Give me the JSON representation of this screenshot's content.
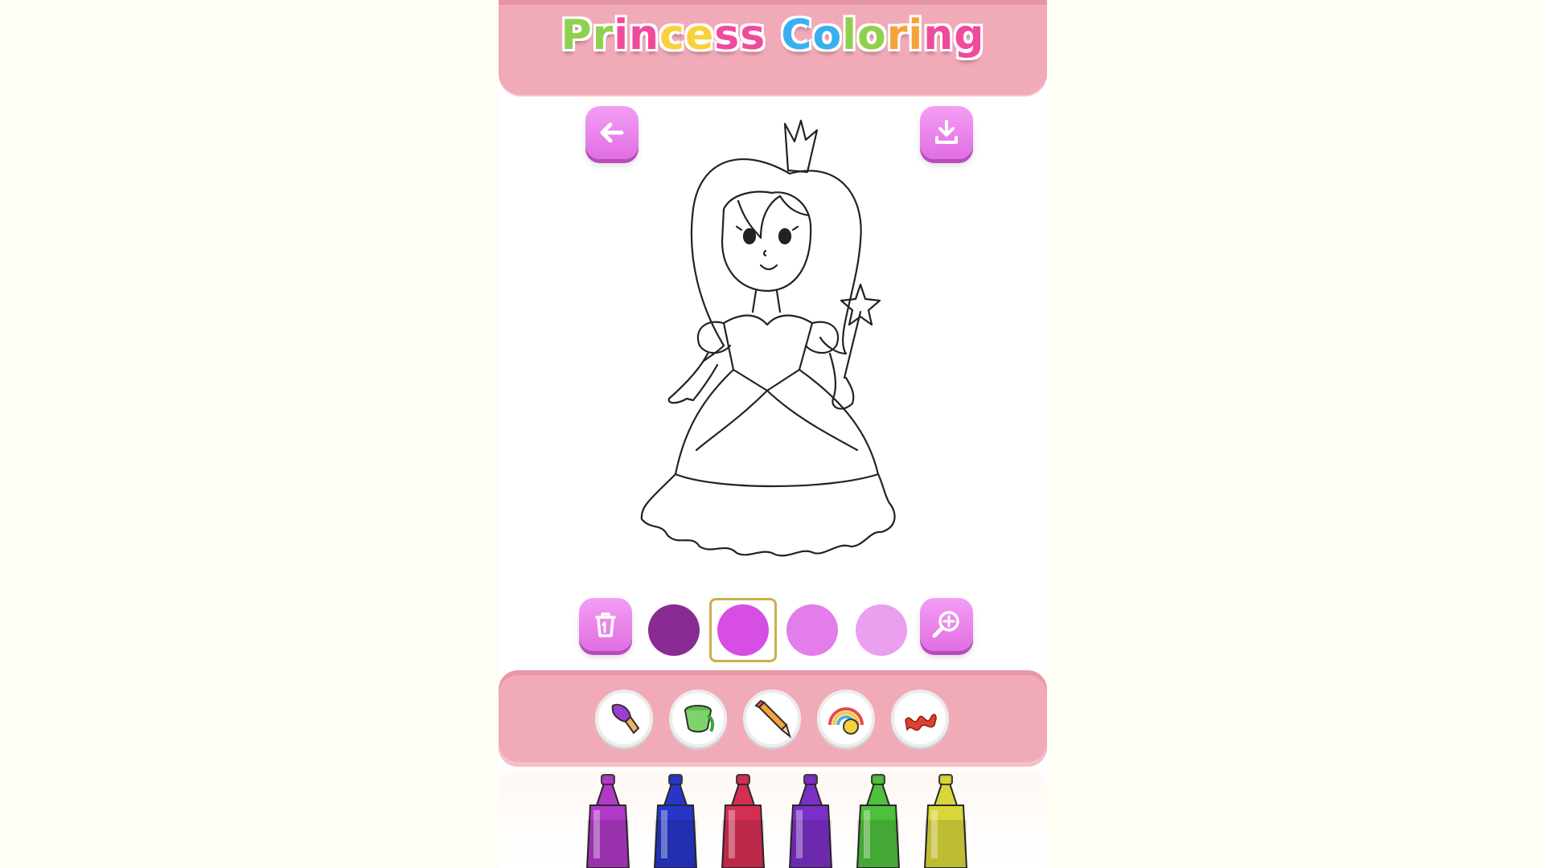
{
  "app": {
    "title_letters": [
      "P",
      "r",
      "i",
      "n",
      "c",
      "e",
      "s",
      "s",
      " ",
      "C",
      "o",
      "l",
      "o",
      "r",
      "i",
      "n",
      "g"
    ],
    "title_colors": [
      "#8fd14f",
      "#8fd14f",
      "#f04a9c",
      "#f04a9c",
      "#f7d23a",
      "#f7d23a",
      "#f04a9c",
      "#f04a9c",
      "#ffffff",
      "#3ab0f0",
      "#3ab0f0",
      "#8fd14f",
      "#8fd14f",
      "#f7a23a",
      "#f7a23a",
      "#f04a9c",
      "#f04a9c"
    ]
  },
  "buttons": {
    "back_icon": "back-arrow-icon",
    "download_icon": "download-icon",
    "trash_icon": "trash-icon",
    "zoom_icon": "zoom-icon"
  },
  "palette": {
    "colors": [
      "#8a2b93",
      "#d64ee3",
      "#e27de9",
      "#ea9fef"
    ],
    "selected_index": 1
  },
  "tools": [
    "brush-icon",
    "paint-bucket-icon",
    "pencil-icon",
    "rainbow-sticker-icon",
    "pattern-icon"
  ],
  "markers": [
    "#b03ac7",
    "#2636c9",
    "#d52e53",
    "#7b2fc7",
    "#4ec03c",
    "#d9d63a"
  ]
}
